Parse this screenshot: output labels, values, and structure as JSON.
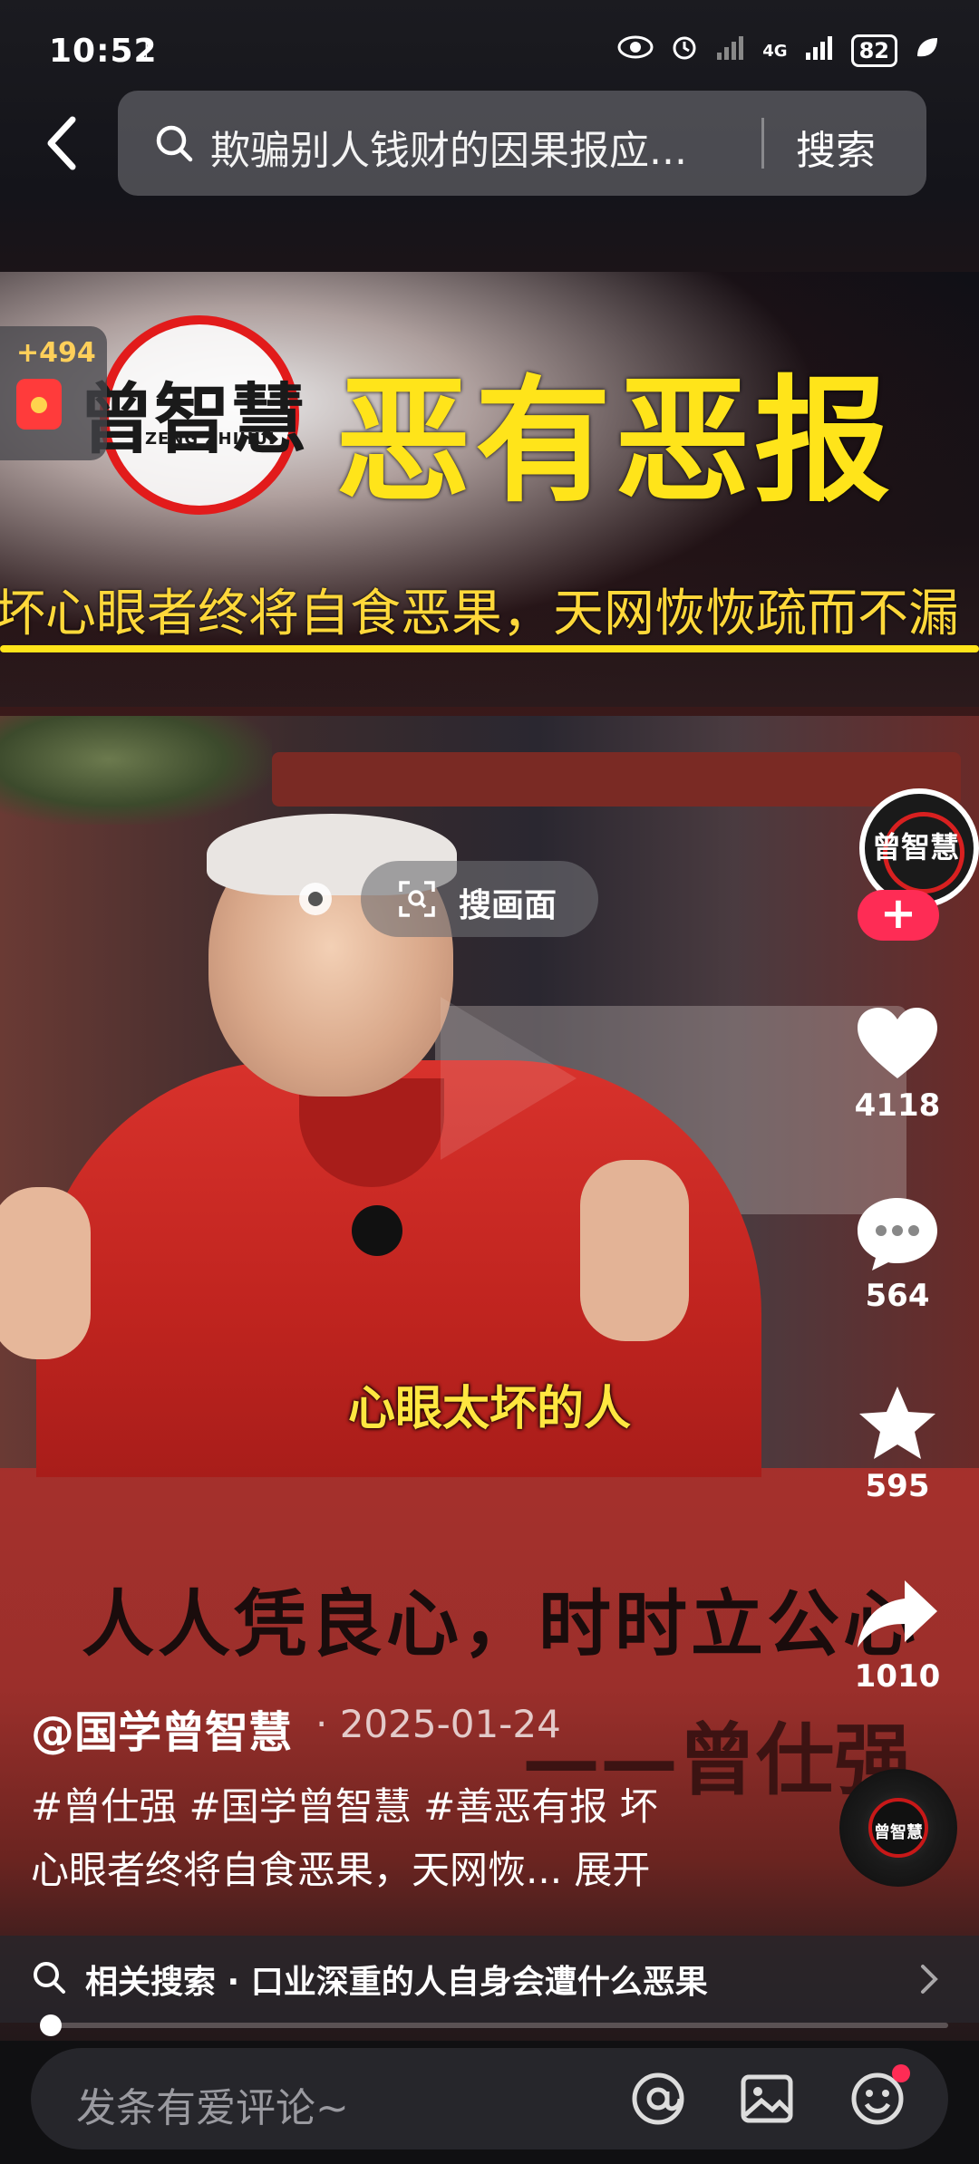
{
  "status_bar": {
    "time": "10:52",
    "network": "4G",
    "battery": "82"
  },
  "search": {
    "query": "欺骗别人钱财的因果报应...",
    "button": "搜索"
  },
  "red_packet": {
    "count": "+494"
  },
  "banner": {
    "logo_name": "曾智慧",
    "logo_sub": "ZENG ZHIHUI",
    "title": "恶有恶报",
    "subtitle": "坏心眼者终将自食恶果，天网恢恢疏而不漏"
  },
  "video": {
    "scan_label": "搜画面",
    "subtitle": "心眼太坏的人"
  },
  "lower_banner": {
    "quote": "人人凭良心，时时立公心",
    "author": "——曾仕强"
  },
  "rail": {
    "avatar_text": "曾智慧",
    "likes": "4118",
    "comments": "564",
    "favorites": "595",
    "shares": "1010",
    "disc_text": "曾智慧"
  },
  "post": {
    "author": "@国学曾智慧",
    "date": "· 2025-01-24",
    "desc_line1": "#曾仕强 #国学曾智慧 #善恶有报 坏",
    "desc_line2": "心眼者终将自食恶果，天网恢...",
    "expand": " 展开"
  },
  "related": {
    "text": "相关搜索 · 口业深重的人自身会遭什么恶果"
  },
  "progress": {
    "played_fraction": 0.01
  },
  "comment": {
    "placeholder": "发条有爱评论~"
  },
  "colors": {
    "accent": "#fe2c55",
    "banner_yellow": "#ffe41a",
    "logo_red": "#e21b1b"
  }
}
